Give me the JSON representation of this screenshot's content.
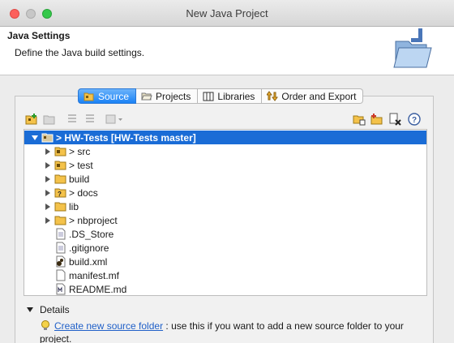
{
  "window": {
    "title": "New Java Project"
  },
  "header": {
    "title": "Java Settings",
    "description": "Define the Java build settings.",
    "icon": "java-folder-icon"
  },
  "tabs": [
    {
      "label": "Source",
      "icon": "source-folder-icon",
      "active": true
    },
    {
      "label": "Projects",
      "icon": "projects-folder-icon",
      "active": false
    },
    {
      "label": "Libraries",
      "icon": "libraries-icon",
      "active": false
    },
    {
      "label": "Order and Export",
      "icon": "order-export-icon",
      "active": false
    }
  ],
  "toolbar": {
    "left_buttons": [
      "add-source-folder-icon",
      "link-source-icon",
      "up-icon",
      "down-icon",
      "configure-dropdown-icon"
    ],
    "right_buttons": [
      "new-folder-icon",
      "add-folder-icon",
      "remove-icon",
      "help-icon"
    ]
  },
  "tree": {
    "items": [
      {
        "label": "> HW-Tests [HW-Tests master]",
        "icon": "project-icon",
        "expanded": true,
        "selected": true
      },
      {
        "label": "> src",
        "icon": "package-folder-icon",
        "has_children": true
      },
      {
        "label": "> test",
        "icon": "package-folder-icon",
        "has_children": true
      },
      {
        "label": "build",
        "icon": "folder-icon",
        "has_children": true
      },
      {
        "label": "> docs",
        "icon": "unknown-folder-icon",
        "has_children": true
      },
      {
        "label": "lib",
        "icon": "folder-icon",
        "has_children": true
      },
      {
        "label": "> nbproject",
        "icon": "folder-icon",
        "has_children": true
      },
      {
        "label": ".DS_Store",
        "icon": "file-icon",
        "has_children": false
      },
      {
        "label": ".gitignore",
        "icon": "file-icon",
        "has_children": false
      },
      {
        "label": "build.xml",
        "icon": "ant-file-icon",
        "has_children": false
      },
      {
        "label": "manifest.mf",
        "icon": "file-icon",
        "has_children": false
      },
      {
        "label": "README.md",
        "icon": "markdown-file-icon",
        "has_children": false
      }
    ]
  },
  "details": {
    "label": "Details",
    "link_text": "Create new source folder",
    "hint_text": ": use this if you want to add a new source folder to your project."
  },
  "colors": {
    "selection": "#1a6cd6",
    "tab_active": "#1a82f6",
    "link": "#2060c8"
  }
}
